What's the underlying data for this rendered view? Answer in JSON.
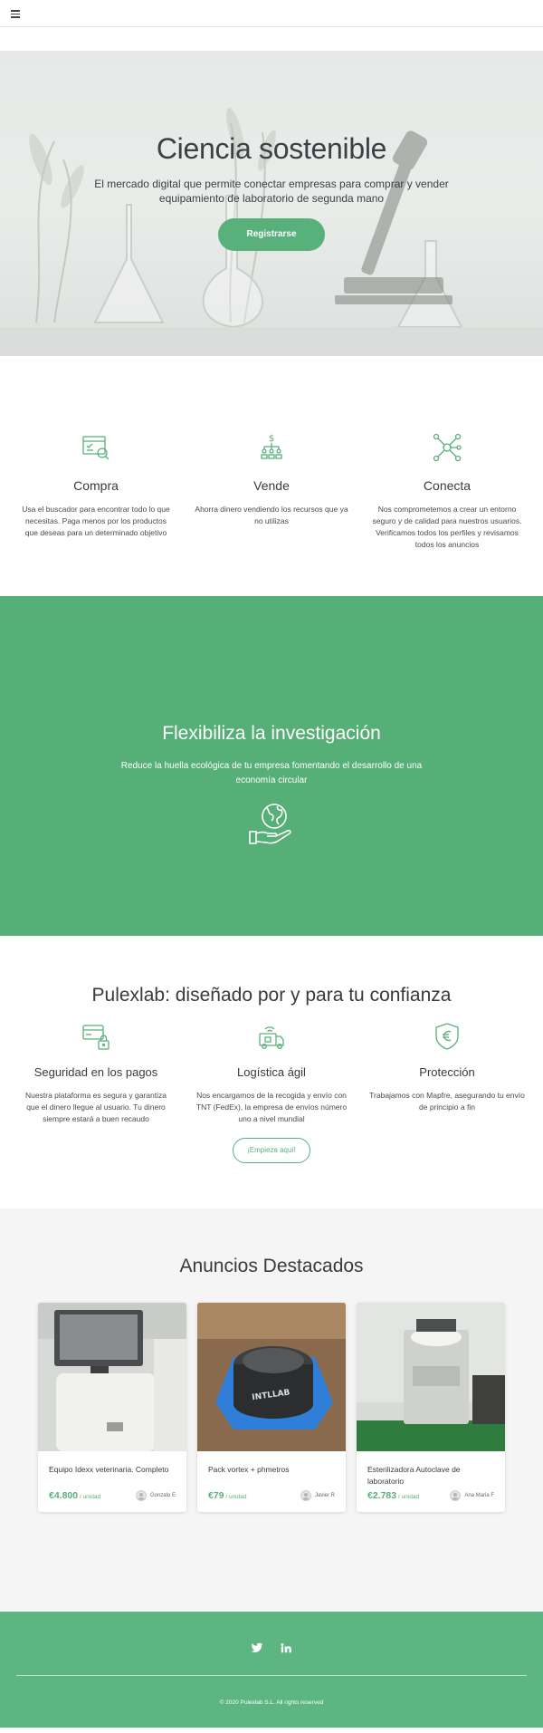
{
  "nav": {
    "menu_icon": "hamburger-icon"
  },
  "hero": {
    "title": "Ciencia sostenible",
    "subtitle": "El mercado digital que permite conectar empresas para comprar y vender equipamiento de laboratorio de segunda mano",
    "cta": "Registrarse"
  },
  "features": [
    {
      "icon": "search-listing-icon",
      "title": "Compra",
      "text": "Usa el buscador para encontrar todo lo que necesitas. Paga menos por los productos que deseas para un determinado objetivo"
    },
    {
      "icon": "money-people-icon",
      "title": "Vende",
      "text": "Ahorra dinero vendiendo los recursos que ya no utilizas"
    },
    {
      "icon": "network-icon",
      "title": "Conecta",
      "text": "Nos comprometemos a crear un entorno seguro y de calidad para nuestros usuarios. Verificamos todos los perfiles y revisamos todos los anuncios"
    }
  ],
  "band": {
    "title": "Flexibiliza la investigación",
    "text": "Reduce la huella ecológica de tu empresa fomentando el desarrollo de una economía circular",
    "icon": "globe-hand-icon"
  },
  "trust": {
    "title": "Pulexlab: diseñado por y para tu confianza",
    "items": [
      {
        "icon": "secure-payment-icon",
        "title": "Seguridad en los pagos",
        "text": "Nuestra plataforma es segura y garantiza que el dinero llegue al usuario. Tu dinero siempre estará a buen recaudo"
      },
      {
        "icon": "delivery-truck-icon",
        "title": "Logística ágil",
        "text": "Nos encargamos de la recogida y envío con TNT (FedEx), la empresa de envíos número uno a nivel mundial"
      },
      {
        "icon": "shield-euro-icon",
        "title": "Protección",
        "text": "Trabajamos con Mapfre, asegurando tu envío de principio a fin"
      }
    ],
    "cta": "¡Empieza aquí!"
  },
  "featured": {
    "title": "Anuncios Destacados",
    "listings": [
      {
        "title": "Equipo Idexx veterinaria. Completo",
        "price": "€4.800",
        "unit": " / unidad",
        "seller": "Gonzalo E"
      },
      {
        "title": "Pack vortex + phmetros",
        "price": "€79",
        "unit": " / unidad",
        "seller": "Javier R"
      },
      {
        "title": "Esterilizadora Autoclave de laboratorio",
        "price": "€2.783",
        "unit": " / unidad",
        "seller": "Ana Maria F"
      }
    ]
  },
  "footer": {
    "social": [
      "twitter-icon",
      "linkedin-icon"
    ],
    "copyright": "© 2020 Pulexlab S.L. All rights reserved"
  },
  "colors": {
    "brand_green": "#58b07a",
    "footer_green": "#5db582"
  }
}
